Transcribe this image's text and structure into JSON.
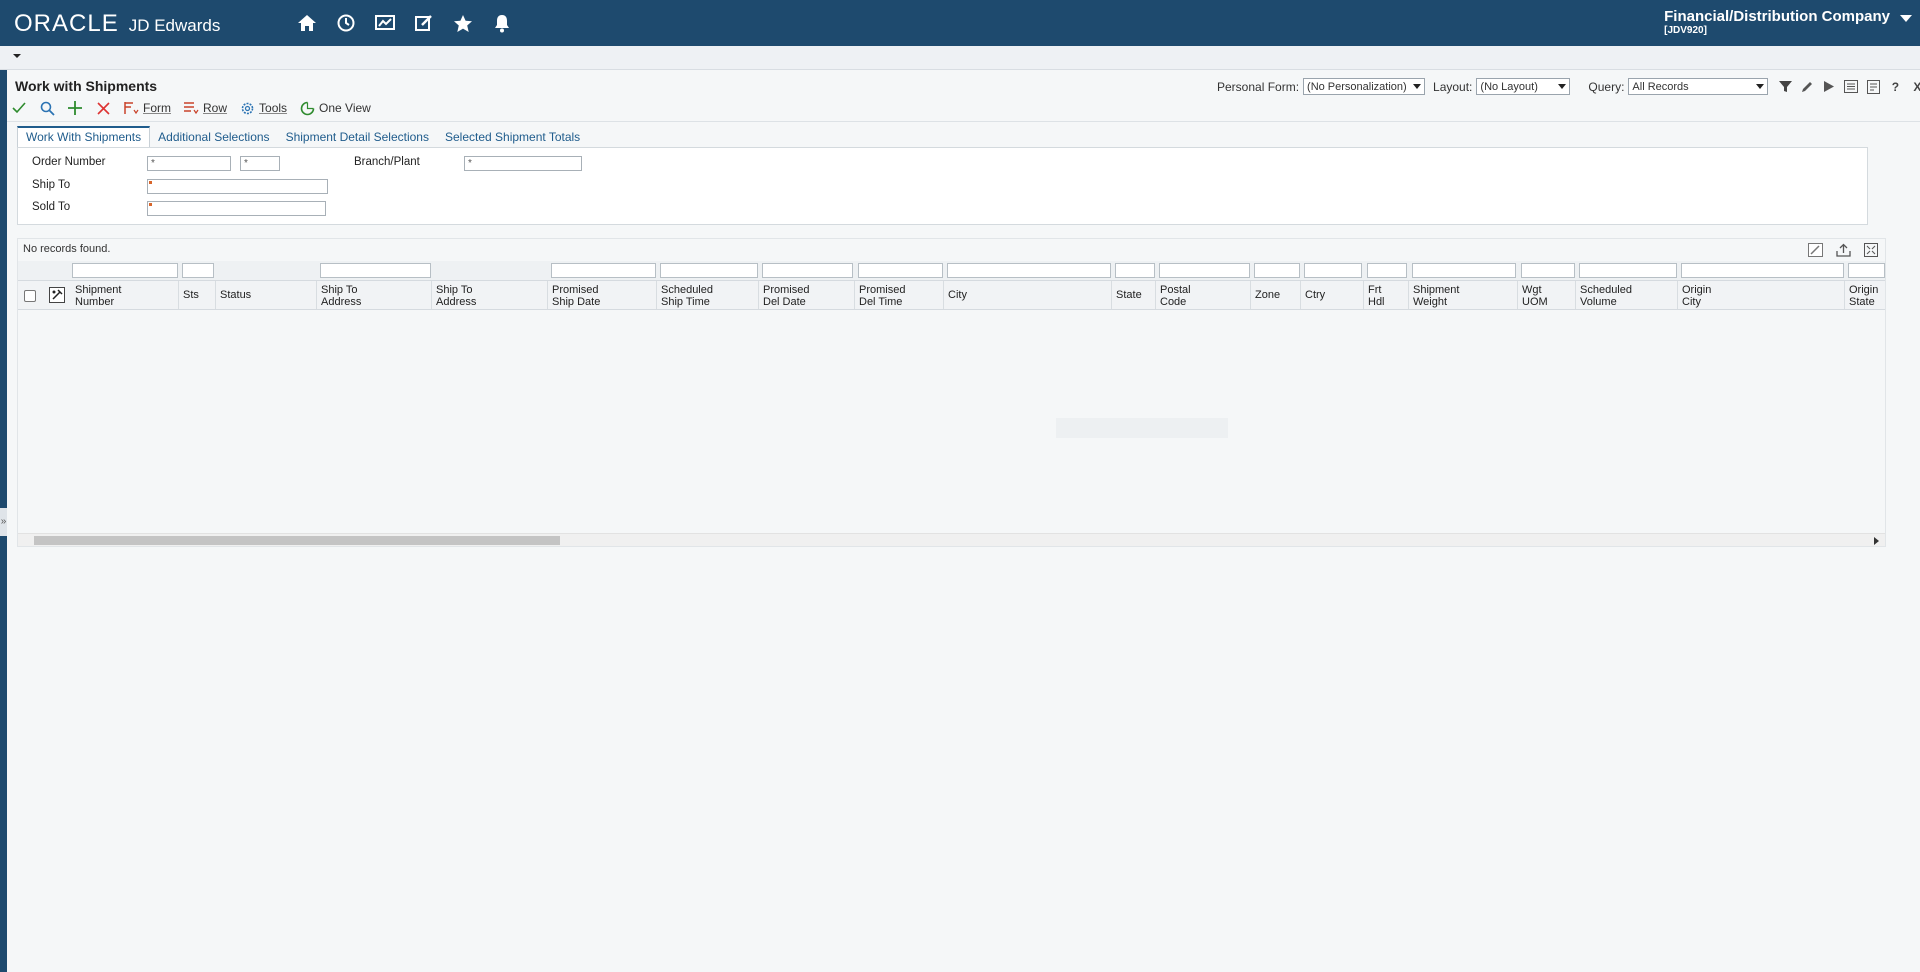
{
  "banner": {
    "logo_oracle": "ORACLE",
    "logo_product": "JD Edwards",
    "company_name": "Financial/Distribution Company",
    "company_env": "[JDV920]",
    "icons": [
      "home-icon",
      "recent-icon",
      "watchlist-icon",
      "edit-icon",
      "favorites-icon",
      "notifications-icon"
    ],
    "color": "#1e4a6e"
  },
  "form": {
    "title": "Work with Shipments",
    "personal_form_label": "Personal Form:",
    "personal_form_value": "(No Personalization)",
    "layout_label": "Layout:",
    "layout_value": "(No Layout)",
    "query_label": "Query:",
    "query_value": "All Records"
  },
  "toolbar": {
    "form_label": "Form",
    "row_label": "Row",
    "tools_label": "Tools",
    "oneview_label": "One View"
  },
  "tabs": [
    "Work With Shipments",
    "Additional Selections",
    "Shipment Detail Selections",
    "Selected Shipment Totals"
  ],
  "criteria": {
    "order_number_label": "Order Number",
    "order_number_value": "*",
    "order_type_value": "*",
    "branch_plant_label": "Branch/Plant",
    "branch_plant_value": "*",
    "ship_to_label": "Ship To",
    "sold_to_label": "Sold To"
  },
  "grid": {
    "status_text": "No records found.",
    "columns": [
      {
        "l1": "Shipment",
        "l2": "Number"
      },
      {
        "l1": "Sts",
        "l2": ""
      },
      {
        "l1": "Status",
        "l2": ""
      },
      {
        "l1": "Ship To",
        "l2": "Address"
      },
      {
        "l1": "Ship To",
        "l2": "Address"
      },
      {
        "l1": "Promised",
        "l2": "Ship Date"
      },
      {
        "l1": "Scheduled",
        "l2": "Ship Time"
      },
      {
        "l1": "Promised",
        "l2": "Del Date"
      },
      {
        "l1": "Promised",
        "l2": "Del Time"
      },
      {
        "l1": "City",
        "l2": ""
      },
      {
        "l1": "State",
        "l2": ""
      },
      {
        "l1": "Postal",
        "l2": "Code"
      },
      {
        "l1": "Zone",
        "l2": ""
      },
      {
        "l1": "Ctry",
        "l2": ""
      },
      {
        "l1": "Frt",
        "l2": "Hdl"
      },
      {
        "l1": "Shipment",
        "l2": "Weight"
      },
      {
        "l1": "Wgt",
        "l2": "UOM"
      },
      {
        "l1": "Scheduled",
        "l2": "Volume"
      },
      {
        "l1": "Origin",
        "l2": "City"
      },
      {
        "l1": "Origin",
        "l2": "State"
      }
    ]
  }
}
